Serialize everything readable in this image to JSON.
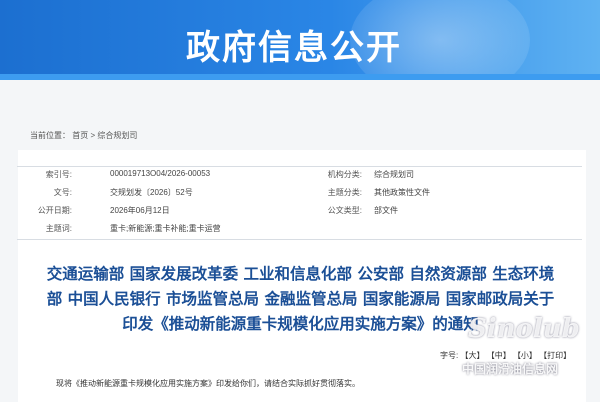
{
  "banner": {
    "title": "政府信息公开"
  },
  "breadcrumb": {
    "label": "当前位置：",
    "home": "首页",
    "sep": ">",
    "current": "综合规划司"
  },
  "meta": {
    "index_label": "索引号:",
    "index_value": "000019713O04/2026-00053",
    "org_label": "机构分类:",
    "org_value": "综合规划司",
    "docno_label": "文号:",
    "docno_value": "交规划发〔2026〕52号",
    "topic_label": "主题分类:",
    "topic_value": "其他政策性文件",
    "date_label": "公开日期:",
    "date_value": "2026年06月12日",
    "type_label": "公文类型:",
    "type_value": "部文件",
    "keywords_label": "主题词:",
    "keywords_value": "重卡;新能源;重卡补能;重卡运营"
  },
  "headline": {
    "line1": "交通运输部 国家发展改革委 工业和信息化部 公安部 自然资源部 生态环境",
    "line2": "部 中国人民银行 市场监管总局 金融监管总局 国家能源局 国家邮政局关于",
    "line3": "印发《推动新能源重卡规模化应用实施方案》的通知"
  },
  "font_size": {
    "label": "字号:",
    "large": "【大】",
    "medium": "【中】",
    "small": "【小】",
    "print": "【打印】"
  },
  "body": {
    "first_line": "现将《推动新能源重卡规模化应用实施方案》印发给你们，请结合实际抓好贯彻落实。"
  },
  "watermark": {
    "brand": "Sinolub",
    "text": "中国润滑油信息网"
  }
}
